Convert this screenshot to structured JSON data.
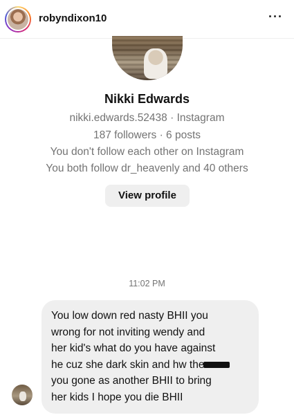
{
  "header": {
    "username": "robyndixon10",
    "more_label": "···",
    "avatar_icon": "user-avatar-icon",
    "ring_colors": [
      "#feda75",
      "#fa7e1e",
      "#d62976",
      "#962fbf",
      "#4f5bd5"
    ]
  },
  "profile": {
    "name": "Nikki Edwards",
    "handle_line": "nikki.edwards.52438 · Instagram",
    "stats_line": "187 followers · 6 posts",
    "follow_status": "You don't follow each other on Instagram",
    "mutual_line": "You both follow dr_heavenly and 40 others",
    "view_profile_label": "View profile"
  },
  "conversation": {
    "timestamp": "11:02 PM",
    "message": {
      "lines": [
        "You low down red nasty BHII you",
        "wrong for not inviting wendy and",
        "her kid's what do you have against",
        "he cuz she dark skin and hw the",
        "you gone as another BHII to bring",
        "her kids I hope you die BHII"
      ],
      "redacted_after_line": 3
    }
  },
  "colors": {
    "muted_text": "#737373",
    "bubble_bg": "#efefef",
    "button_bg": "#efefef"
  }
}
